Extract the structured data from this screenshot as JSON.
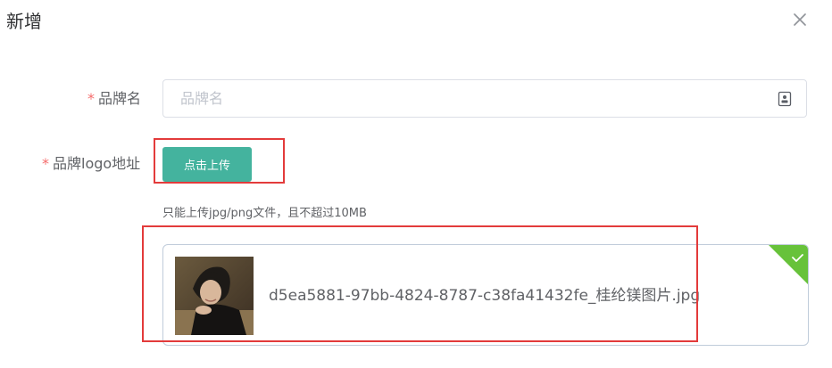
{
  "dialog": {
    "title": "新增",
    "close_icon": "close-icon"
  },
  "form": {
    "brand_name": {
      "required_mark": "*",
      "label": "品牌名",
      "placeholder": "品牌名",
      "value": "",
      "suffix_icon": "contact-card-icon"
    },
    "brand_logo": {
      "required_mark": "*",
      "label": "品牌logo地址",
      "upload_button_label": "点击上传",
      "tip": "只能上传jpg/png文件，且不超过10MB",
      "file": {
        "name": "d5ea5881-97bb-4824-8787-c38fa41432fe_桂纶镁图片.jpg",
        "status": "success",
        "status_icon": "checkmark-icon",
        "thumbnail": "photo-thumbnail"
      }
    }
  },
  "colors": {
    "primary_button": "#44b39e",
    "success_corner": "#67c23a",
    "required": "#f56c6c",
    "highlight_box": "#e33b3b"
  }
}
